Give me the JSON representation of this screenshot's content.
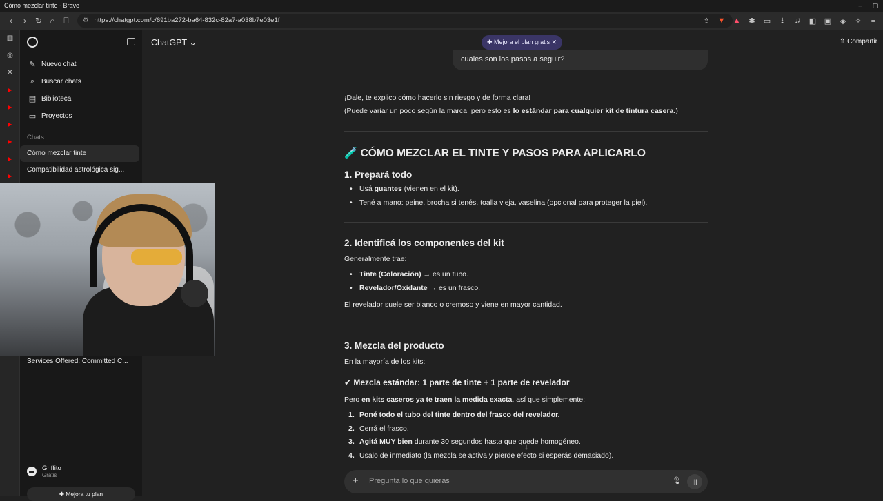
{
  "window": {
    "title": "Cómo mezclar tinte - Brave"
  },
  "browser": {
    "url": "https://chatgpt.com/c/691ba272-ba64-832c-82a7-a038b7e03e1f"
  },
  "sidebar": {
    "items": [
      {
        "label": "Nuevo chat",
        "icon": "new-chat-icon"
      },
      {
        "label": "Buscar chats",
        "icon": "search-icon"
      },
      {
        "label": "Biblioteca",
        "icon": "library-icon"
      },
      {
        "label": "Proyectos",
        "icon": "folder-icon"
      }
    ],
    "section_label": "Chats",
    "chats": [
      "Cómo mezclar tinte",
      "Compatibilidad astrológica sig..."
    ],
    "chat_hidden_label": "Services Offered: Committed C...",
    "user": {
      "name": "Griffito",
      "plan": "Gratis"
    },
    "upgrade_label": "Mejora tu plan"
  },
  "topbar": {
    "model": "ChatGPT",
    "upgrade_pill": "✚ Mejora el plan gratis",
    "share": "Compartir"
  },
  "conversation": {
    "user_message_tail": "cuales son los pasos a seguir?",
    "intro_1": "¡Dale, te explico cómo hacerlo sin riesgo y de forma clara!",
    "intro_2_pre": "(Puede variar un poco según la marca, pero esto es ",
    "intro_2_bold": "lo estándar para cualquier kit de tintura casera.",
    "intro_2_post": ")",
    "h_main": "🧪 CÓMO MEZCLAR EL TINTE Y PASOS PARA APLICARLO",
    "s1": {
      "title": "1. Prepará todo",
      "b1_pre": "Usá ",
      "b1_bold": "guantes",
      "b1_post": " (vienen en el kit).",
      "b2": "Tené a mano: peine, brocha si tenés, toalla vieja, vaselina (opcional para proteger la piel)."
    },
    "s2": {
      "title": "2. Identificá los componentes del kit",
      "lead": "Generalmente trae:",
      "b1_bold": "Tinte (Coloración)",
      "b1_post": " → es un tubo.",
      "b2_bold": "Revelador/Oxidante",
      "b2_post": " → es un frasco.",
      "note": "El revelador suele ser blanco o cremoso y viene en mayor cantidad."
    },
    "s3": {
      "title": "3. Mezcla del producto",
      "lead": "En la mayoría de los kits:",
      "std": "✔ Mezcla estándar: 1 parte de tinte + 1 parte de revelador",
      "p_pre": "Pero ",
      "p_bold": "en kits caseros ya te traen la medida exacta",
      "p_post": ", así que simplemente:",
      "steps": [
        {
          "n": "1.",
          "bold": "Poné todo el tubo del tinte dentro del frasco del revelador.",
          "rest": ""
        },
        {
          "n": "2.",
          "bold": "",
          "rest": "Cerrá el frasco."
        },
        {
          "n": "3.",
          "bold": "Agitá MUY bien",
          "rest": " durante 30 segundos hasta que quede homogéneo."
        },
        {
          "n": "4.",
          "bold": "",
          "rest": "Usalo de inmediato (la mezcla se activa y pierde efecto si esperás demasiado)."
        }
      ]
    }
  },
  "composer": {
    "placeholder": "Pregunta lo que quieras"
  },
  "colors": {
    "background": "#212121",
    "sidebar": "#181818",
    "pill": "#3a3566"
  }
}
